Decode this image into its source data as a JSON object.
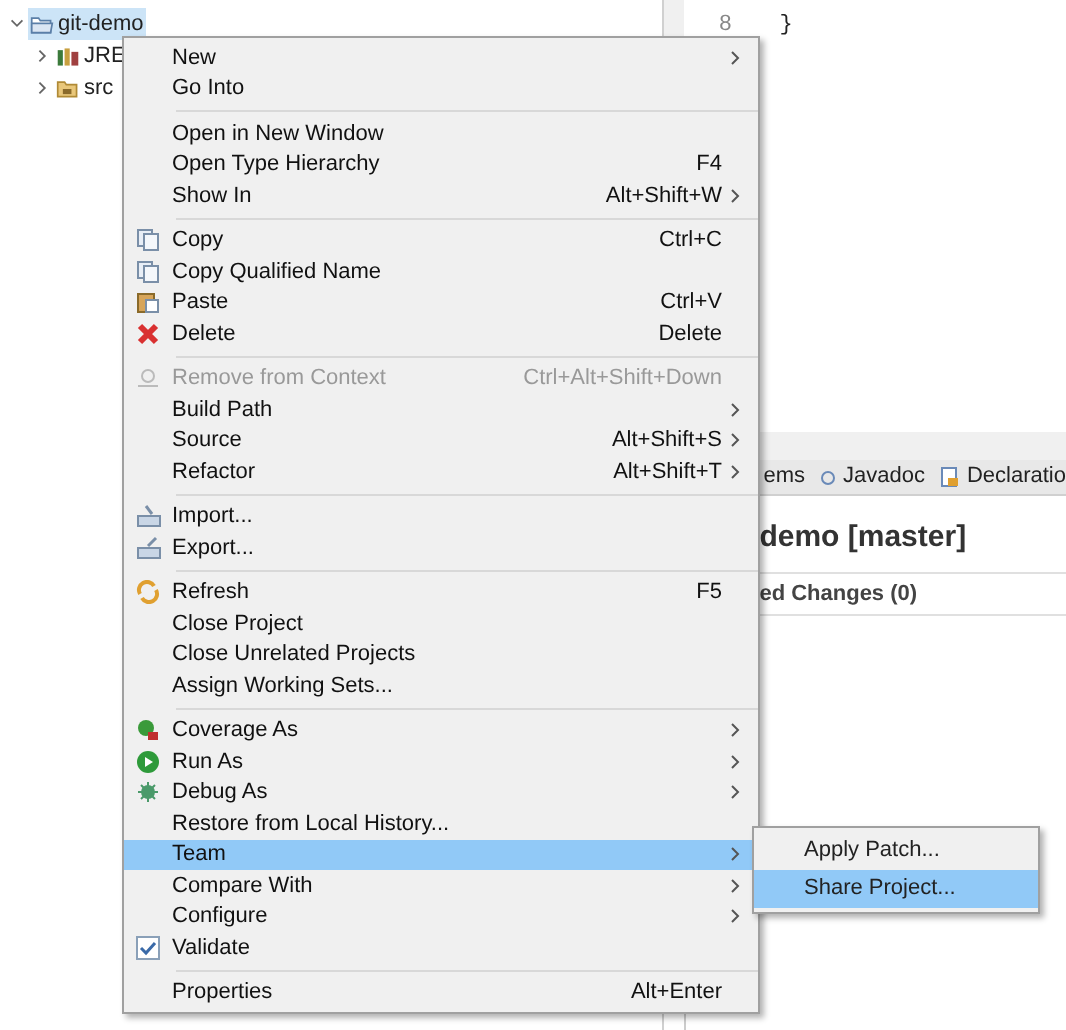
{
  "tree": [
    {
      "label": "git-demo",
      "expanded": true,
      "selected": true
    },
    {
      "label": "JRE",
      "expanded": false,
      "selected": false
    },
    {
      "label": "src",
      "expanded": false,
      "selected": false
    }
  ],
  "editor": {
    "line_number": "8",
    "code": "}"
  },
  "bottom_panel": {
    "tabs": [
      {
        "label": "ems"
      },
      {
        "label": "Javadoc"
      },
      {
        "label": "Declaratio"
      }
    ],
    "title": "demo [master]",
    "section": "ed Changes (0)"
  },
  "context_menu": {
    "groups": [
      [
        {
          "label": "New",
          "submenu": true,
          "disabled": false,
          "selected": false
        },
        {
          "label": "Go Into",
          "submenu": false,
          "disabled": false,
          "selected": false
        }
      ],
      [
        {
          "label": "Open in New Window",
          "submenu": false,
          "disabled": false,
          "selected": false
        },
        {
          "label": "Open Type Hierarchy",
          "shortcut": "F4",
          "submenu": false,
          "disabled": false,
          "selected": false
        },
        {
          "label": "Show In",
          "shortcut": "Alt+Shift+W",
          "submenu": true,
          "disabled": false,
          "selected": false
        }
      ],
      [
        {
          "label": "Copy",
          "shortcut": "Ctrl+C",
          "submenu": false,
          "disabled": false,
          "selected": false
        },
        {
          "label": "Copy Qualified Name",
          "submenu": false,
          "disabled": false,
          "selected": false
        },
        {
          "label": "Paste",
          "shortcut": "Ctrl+V",
          "submenu": false,
          "disabled": false,
          "selected": false
        },
        {
          "label": "Delete",
          "shortcut": "Delete",
          "submenu": false,
          "disabled": false,
          "selected": false
        }
      ],
      [
        {
          "label": "Remove from Context",
          "shortcut": "Ctrl+Alt+Shift+Down",
          "submenu": false,
          "disabled": true,
          "selected": false
        },
        {
          "label": "Build Path",
          "submenu": true,
          "disabled": false,
          "selected": false
        },
        {
          "label": "Source",
          "shortcut": "Alt+Shift+S",
          "submenu": true,
          "disabled": false,
          "selected": false
        },
        {
          "label": "Refactor",
          "shortcut": "Alt+Shift+T",
          "submenu": true,
          "disabled": false,
          "selected": false
        }
      ],
      [
        {
          "label": "Import...",
          "submenu": false,
          "disabled": false,
          "selected": false
        },
        {
          "label": "Export...",
          "submenu": false,
          "disabled": false,
          "selected": false
        }
      ],
      [
        {
          "label": "Refresh",
          "shortcut": "F5",
          "submenu": false,
          "disabled": false,
          "selected": false
        },
        {
          "label": "Close Project",
          "submenu": false,
          "disabled": false,
          "selected": false
        },
        {
          "label": "Close Unrelated Projects",
          "submenu": false,
          "disabled": false,
          "selected": false
        },
        {
          "label": "Assign Working Sets...",
          "submenu": false,
          "disabled": false,
          "selected": false
        }
      ],
      [
        {
          "label": "Coverage As",
          "submenu": true,
          "disabled": false,
          "selected": false
        },
        {
          "label": "Run As",
          "submenu": true,
          "disabled": false,
          "selected": false
        },
        {
          "label": "Debug As",
          "submenu": true,
          "disabled": false,
          "selected": false
        },
        {
          "label": "Restore from Local History...",
          "submenu": false,
          "disabled": false,
          "selected": false
        },
        {
          "label": "Team",
          "submenu": true,
          "disabled": false,
          "selected": true
        },
        {
          "label": "Compare With",
          "submenu": true,
          "disabled": false,
          "selected": false
        },
        {
          "label": "Configure",
          "submenu": true,
          "disabled": false,
          "selected": false
        },
        {
          "label": "Validate",
          "submenu": false,
          "disabled": false,
          "selected": false
        }
      ],
      [
        {
          "label": "Properties",
          "shortcut": "Alt+Enter",
          "submenu": false,
          "disabled": false,
          "selected": false
        }
      ]
    ]
  },
  "team_submenu": [
    {
      "label": "Apply Patch...",
      "selected": false
    },
    {
      "label": "Share Project...",
      "selected": true
    }
  ]
}
